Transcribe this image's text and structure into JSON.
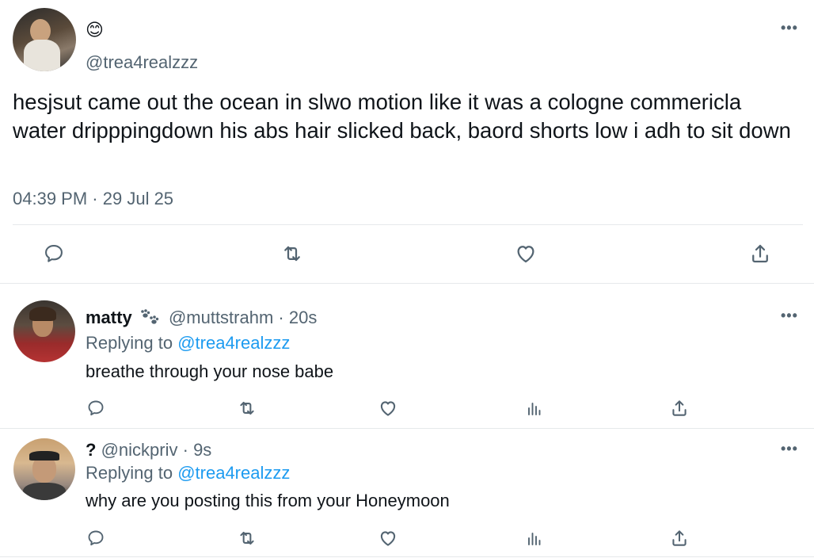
{
  "main_tweet": {
    "emoji": "😊",
    "handle": "@trea4realzzz",
    "text": "hesjsut came out the ocean in slwo motion like it was a cologne commericla water dripppingdown his abs hair slicked back, baord shorts low i adh to sit down",
    "time": "04:39 PM",
    "separator": "·",
    "date": "29 Jul 25",
    "more_label": "•••",
    "actions": [
      "reply-icon",
      "retweet-icon",
      "like-icon",
      "share-icon"
    ]
  },
  "replies": [
    {
      "display_name": "matty",
      "badge_icon": "paw-prints-icon",
      "handle": "@muttstrahm",
      "separator": "·",
      "time": "20s",
      "replying_to_label": "Replying to",
      "replying_to_handle": "@trea4realzzz",
      "text": "breathe through your nose babe",
      "more_label": "•••"
    },
    {
      "display_name": "?",
      "handle": "@nickpriv",
      "separator": "·",
      "time": "9s",
      "replying_to_label": "Replying to",
      "replying_to_handle": "@trea4realzzz",
      "text": "why are you posting this from your Honeymoon",
      "more_label": "•••"
    }
  ],
  "colors": {
    "text": "#0f1419",
    "muted": "#536471",
    "link": "#1d9bf0",
    "divider": "#e6e9eb"
  }
}
